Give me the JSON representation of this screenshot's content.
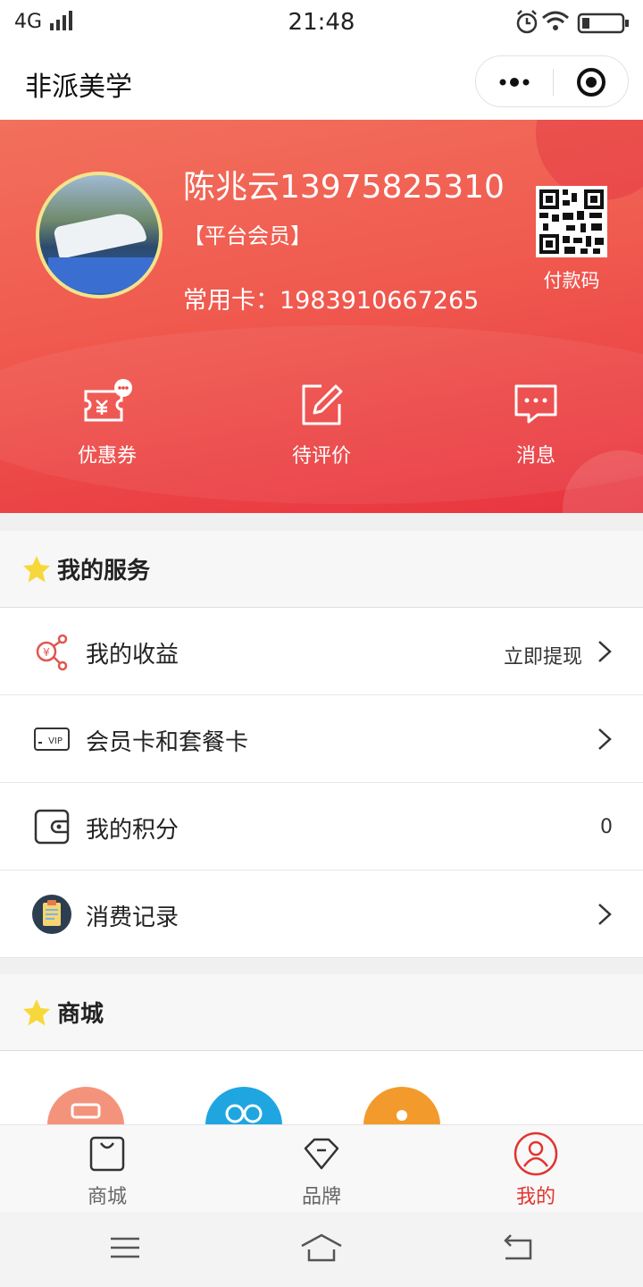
{
  "status_bar": {
    "network": "4G",
    "time": "21:48"
  },
  "header": {
    "title": "非派美学"
  },
  "profile": {
    "name": "陈兆云13975825310",
    "level": "【平台会员】",
    "card_label": "常用卡：",
    "card_number": "1983910667265",
    "qr_label": "付款码"
  },
  "quick_actions": [
    {
      "label": "优惠券",
      "icon": "coupon-icon"
    },
    {
      "label": "待评价",
      "icon": "edit-icon"
    },
    {
      "label": "消息",
      "icon": "message-icon"
    }
  ],
  "services": {
    "title": "我的服务",
    "items": [
      {
        "label": "我的收益",
        "value": "立即提现",
        "icon": "earnings-icon",
        "chevron": true
      },
      {
        "label": "会员卡和套餐卡",
        "value": "",
        "icon": "vip-card-icon",
        "chevron": true
      },
      {
        "label": "我的积分",
        "value": "0",
        "icon": "wallet-icon",
        "chevron": false
      },
      {
        "label": "消费记录",
        "value": "",
        "icon": "record-icon",
        "chevron": true
      }
    ]
  },
  "mall": {
    "title": "商城"
  },
  "tab_bar": {
    "items": [
      {
        "label": "商城",
        "icon": "bag-icon"
      },
      {
        "label": "品牌",
        "icon": "diamond-icon"
      },
      {
        "label": "我的",
        "icon": "profile-icon",
        "active": true
      }
    ]
  },
  "colors": {
    "accent": "#e2342f",
    "hero_start": "#f2705c",
    "hero_end": "#e8343f",
    "star": "#f7d83a"
  }
}
